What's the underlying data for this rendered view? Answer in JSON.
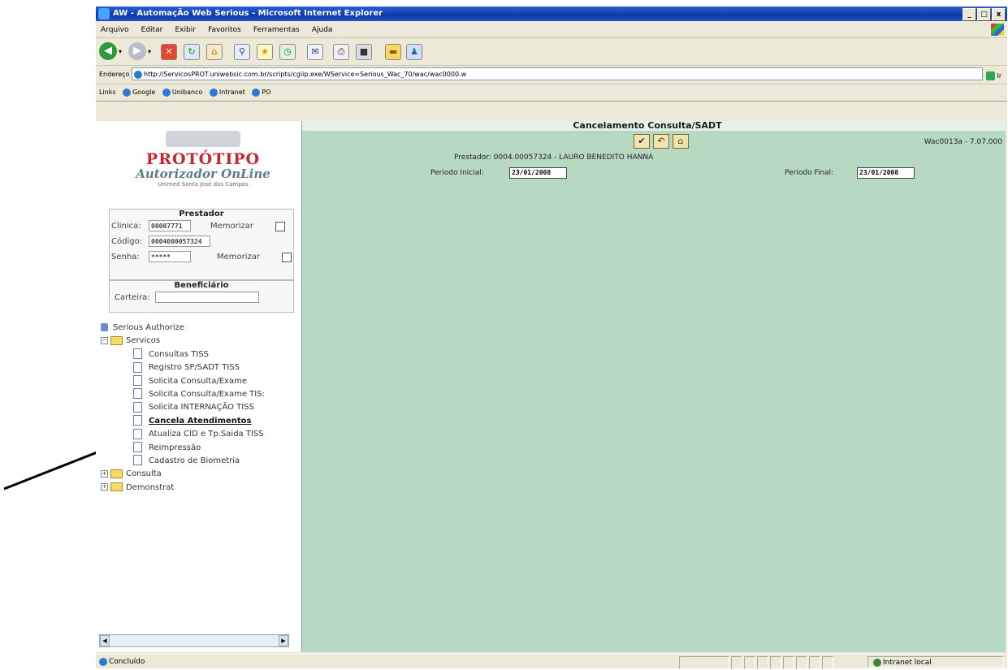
{
  "window": {
    "title": "AW - AutomaçÃo Web Serious - Microsoft Internet Explorer",
    "controls": [
      "_",
      "□",
      "x"
    ]
  },
  "menu": [
    "Arquivo",
    "Editar",
    "Exibir",
    "Favoritos",
    "Ferramentas",
    "Ajuda"
  ],
  "toolbar": {
    "icons": [
      "back-icon",
      "forward-icon",
      "stop-icon",
      "refresh-icon",
      "home-icon",
      "search-icon",
      "favorites-icon",
      "history-icon",
      "mail-icon",
      "print-icon",
      "edit-icon",
      "folder-icon",
      "messenger-icon"
    ]
  },
  "address": {
    "label": "Endereço",
    "url": "http://ServicosPROT.uniwebsic.com.br/scripts/cgiip.exe/WService=Serious_Wac_70/wac/wac0000.w",
    "go_label": "Ir"
  },
  "links": {
    "label": "Links",
    "items": [
      "Google",
      "Unibanco",
      "Intranet",
      "PO"
    ]
  },
  "logo": {
    "line1": "PROTÓTIPO",
    "line2": "Autorizador OnLine",
    "line3": "Unimed Santa José dos Campos"
  },
  "prestador_box": {
    "title": "Prestador",
    "clinica_label": "Clinica:",
    "clinica_value": "00007771",
    "memorizar_label": "Memorizar",
    "codigo_label": "Código:",
    "codigo_value": "0004000057324",
    "senha_label": "Senha:",
    "senha_value": "*****"
  },
  "beneficiario_box": {
    "title": "Beneficiário",
    "carteira_label": "Carteira:",
    "carteira_value": ""
  },
  "tree": {
    "root": "Serious Authorize",
    "servicos": "Servicos",
    "children": [
      "Consultas TISS",
      "Registro SP/SADT TISS",
      "Solicita Consulta/Exame",
      "Solicita Consulta/Exame TIS:",
      "Solicita INTERNAÇÃO TISS",
      "Cancela Atendimentos",
      "Atualiza CID e Tp.Saida TISS",
      "Reimpressão",
      "Cadastro de Biometria"
    ],
    "consulta": "Consulta",
    "demonstrat": "Demonstrat"
  },
  "main": {
    "title": "Cancelamento Consulta/SADT",
    "version": "Wac0013a - 7.07.000",
    "prestador_line": "Prestador: 0004.00057324 - LAURO BENEDITO HANNA",
    "periodo_inicial_label": "Periodo Inicial:",
    "periodo_inicial_value": "23/01/2008",
    "periodo_final_label": "Periodo Final:",
    "periodo_final_value": "23/01/2008"
  },
  "status": {
    "text": "Concluído",
    "zone": "Intranet local"
  }
}
